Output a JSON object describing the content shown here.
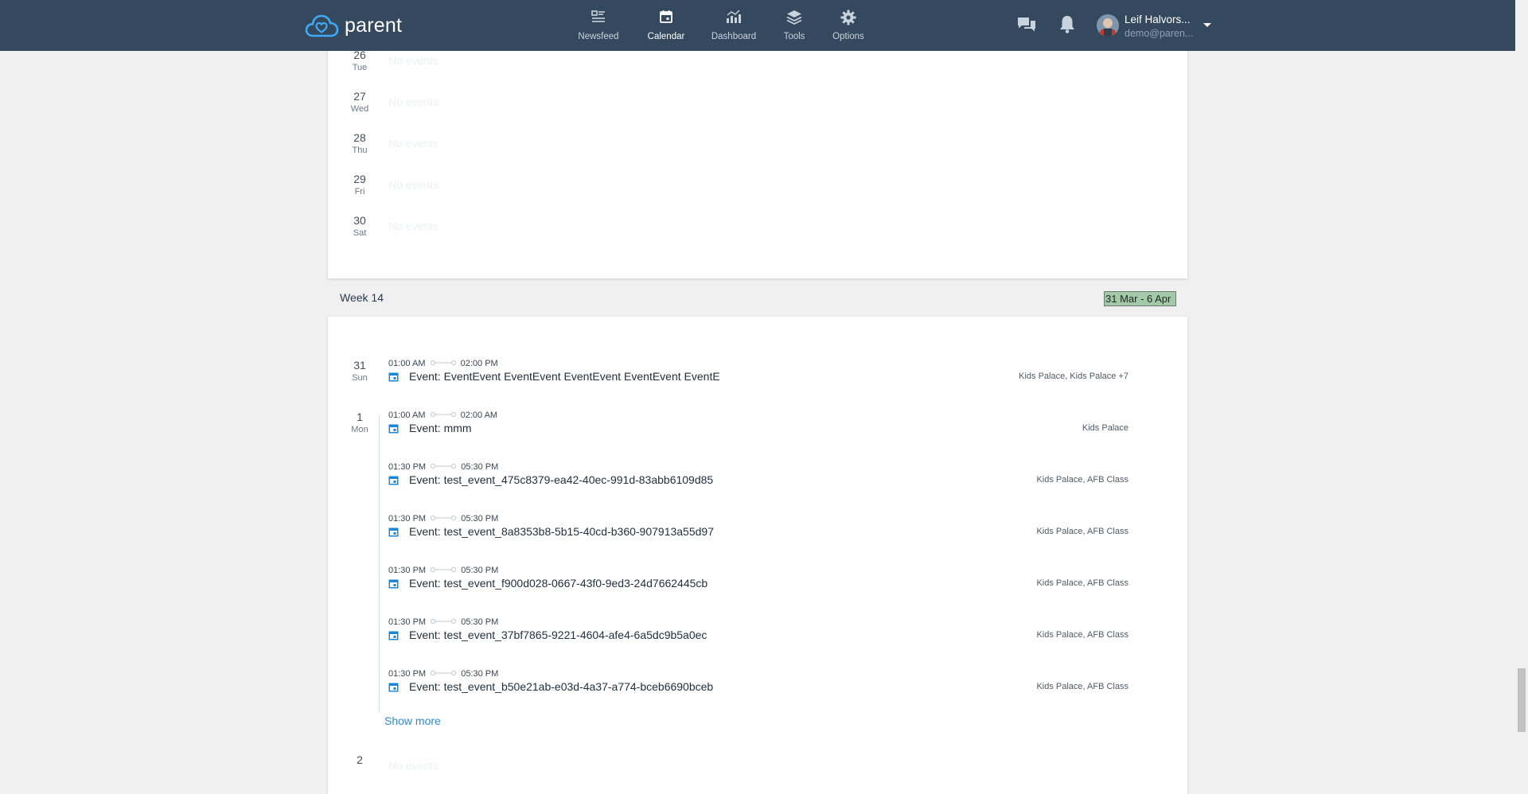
{
  "app": {
    "logo_text": "parent"
  },
  "nav": {
    "items": [
      {
        "label": "Newsfeed",
        "icon": "newsfeed-icon",
        "active": false
      },
      {
        "label": "Calendar",
        "icon": "calendar-icon",
        "active": true
      },
      {
        "label": "Dashboard",
        "icon": "dashboard-icon",
        "active": false
      },
      {
        "label": "Tools",
        "icon": "tools-icon",
        "active": false
      },
      {
        "label": "Options",
        "icon": "options-icon",
        "active": false
      }
    ]
  },
  "user": {
    "name": "Leif Halvors...",
    "email": "demo@paren..."
  },
  "previous_week": {
    "days": [
      {
        "num": "26",
        "name": "Tue",
        "empty_text": "No events"
      },
      {
        "num": "27",
        "name": "Wed",
        "empty_text": "No events"
      },
      {
        "num": "28",
        "name": "Thu",
        "empty_text": "No events"
      },
      {
        "num": "29",
        "name": "Fri",
        "empty_text": "No events"
      },
      {
        "num": "30",
        "name": "Sat",
        "empty_text": "No events"
      }
    ]
  },
  "week": {
    "title": "Week 14",
    "range": "31 Mar - 6 Apr",
    "days": [
      {
        "num": "31",
        "name": "Sun"
      },
      {
        "num": "1",
        "name": "Mon"
      },
      {
        "num": "2",
        "name": "",
        "empty_text": "No events"
      }
    ],
    "events": [
      {
        "start": "01:00 AM",
        "end": "02:00 PM",
        "title": "Event: EventEvent EventEvent EventEvent EventEvent EventE",
        "location": "Kids Palace, Kids Palace  +7"
      },
      {
        "start": "01:00 AM",
        "end": "02:00 AM",
        "title": "Event: mmm",
        "location": "Kids Palace"
      },
      {
        "start": "01:30 PM",
        "end": "05:30 PM",
        "title": "Event: test_event_475c8379-ea42-40ec-991d-83abb6109d85",
        "location": "Kids Palace, AFB Class"
      },
      {
        "start": "01:30 PM",
        "end": "05:30 PM",
        "title": "Event: test_event_8a8353b8-5b15-40cd-b360-907913a55d97",
        "location": "Kids Palace, AFB Class"
      },
      {
        "start": "01:30 PM",
        "end": "05:30 PM",
        "title": "Event: test_event_f900d028-0667-43f0-9ed3-24d7662445cb",
        "location": "Kids Palace, AFB Class"
      },
      {
        "start": "01:30 PM",
        "end": "05:30 PM",
        "title": "Event: test_event_37bf7865-9221-4604-afe4-6a5dc9b5a0ec",
        "location": "Kids Palace, AFB Class"
      },
      {
        "start": "01:30 PM",
        "end": "05:30 PM",
        "title": "Event: test_event_b50e21ab-e03d-4a37-a774-bceb6690bceb",
        "location": "Kids Palace, AFB Class"
      }
    ],
    "show_more": "Show more"
  },
  "colors": {
    "topbar": "#34495e",
    "accent": "#2e8bd8",
    "range_highlight": "#a3c9a8"
  }
}
